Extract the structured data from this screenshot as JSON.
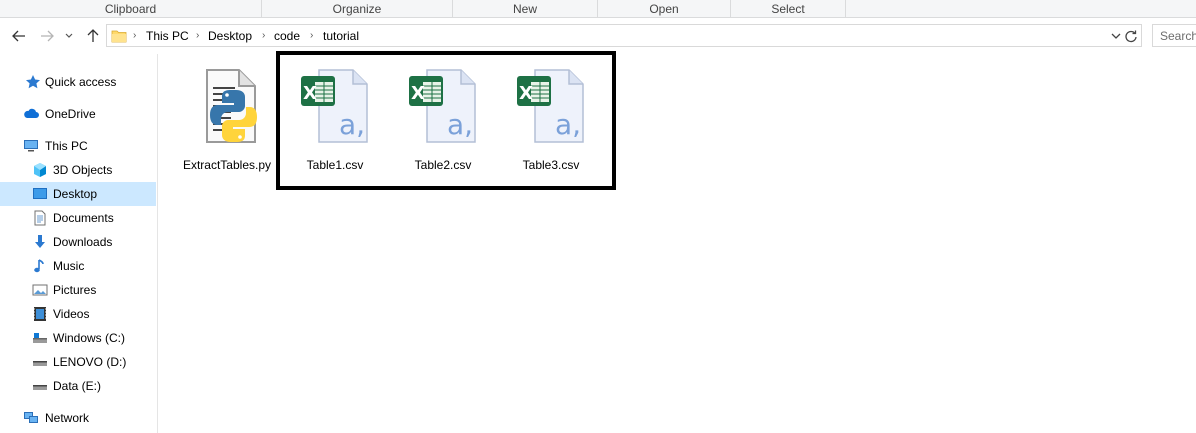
{
  "ribbon": {
    "groups": [
      "Clipboard",
      "Organize",
      "New",
      "Open",
      "Select"
    ]
  },
  "address_bar": {
    "path": [
      "This PC",
      "Desktop",
      "code",
      "tutorial"
    ]
  },
  "search": {
    "placeholder": "Search"
  },
  "nav_pane": {
    "items": [
      {
        "label": "Quick access",
        "icon": "star-icon"
      },
      {
        "label": "OneDrive",
        "icon": "cloud-icon"
      },
      {
        "label": "This PC",
        "icon": "computer-icon"
      },
      {
        "label": "3D Objects",
        "icon": "cube-icon"
      },
      {
        "label": "Desktop",
        "icon": "desktop-icon",
        "selected": true
      },
      {
        "label": "Documents",
        "icon": "document-icon"
      },
      {
        "label": "Downloads",
        "icon": "download-icon"
      },
      {
        "label": "Music",
        "icon": "music-icon"
      },
      {
        "label": "Pictures",
        "icon": "pictures-icon"
      },
      {
        "label": "Videos",
        "icon": "video-icon"
      },
      {
        "label": "Windows (C:)",
        "icon": "drive-icon"
      },
      {
        "label": "LENOVO (D:)",
        "icon": "drive-icon"
      },
      {
        "label": "Data (E:)",
        "icon": "drive-icon"
      },
      {
        "label": "Network",
        "icon": "network-icon"
      }
    ]
  },
  "files": [
    {
      "name": "ExtractTables.py",
      "icon": "python-file-icon"
    },
    {
      "name": "Table1.csv",
      "icon": "csv-file-icon"
    },
    {
      "name": "Table2.csv",
      "icon": "csv-file-icon"
    },
    {
      "name": "Table3.csv",
      "icon": "csv-file-icon"
    }
  ],
  "colors": {
    "selection": "#cce8ff",
    "highlight_border": "#000000",
    "excel_green": "#1e7145",
    "python_blue": "#3776ab",
    "python_yellow": "#ffd43b"
  }
}
